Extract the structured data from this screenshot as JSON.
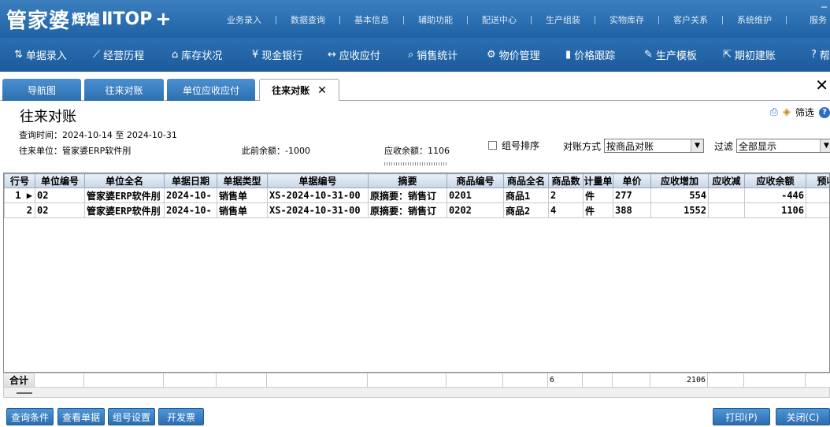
{
  "app": {
    "logo_brand": "管家婆",
    "logo_series": "辉煌",
    "logo_edition": "ⅡTOP",
    "logo_plus": "+"
  },
  "top_menu": [
    "业务录入",
    "数据查询",
    "基本信息",
    "辅助功能",
    "配送中心",
    "生产组装",
    "实物库存",
    "客户关系",
    "系统维护",
    "服务"
  ],
  "toolbar": [
    {
      "label": "单据录入",
      "icon": "document-entry-icon",
      "glyph": "⇅"
    },
    {
      "label": "经营历程",
      "icon": "chart-icon",
      "glyph": "📈"
    },
    {
      "label": "库存状况",
      "icon": "warehouse-icon",
      "glyph": "⌂"
    },
    {
      "label": "现金银行",
      "icon": "yen-icon",
      "glyph": "¥"
    },
    {
      "label": "应收应付",
      "icon": "exchange-icon",
      "glyph": "↔"
    },
    {
      "label": "销售统计",
      "icon": "search-icon",
      "glyph": "⌕"
    },
    {
      "label": "物价管理",
      "icon": "gear-icon",
      "glyph": "⚙"
    },
    {
      "label": "价格跟踪",
      "icon": "bar-chart-icon",
      "glyph": "▮"
    },
    {
      "label": "生产模板",
      "icon": "wrench-icon",
      "glyph": "✎"
    },
    {
      "label": "期初建账",
      "icon": "external-link-icon",
      "glyph": "⇱"
    },
    {
      "label": "帮",
      "icon": "help-icon",
      "glyph": "?"
    }
  ],
  "tabs": [
    {
      "label": "导航图"
    },
    {
      "label": "往来对账"
    },
    {
      "label": "单位应收应付"
    },
    {
      "label": "往来对账",
      "active": true,
      "close": "✕"
    }
  ],
  "close_all": "✕",
  "page": {
    "title": "往来对账",
    "query_time": "查询时间：2024-10-14 至 2024-10-31",
    "unit": "往来单位：管家婆ERP软件刖",
    "prev_balance": "此前余额：-1000",
    "receivable_balance": "应收余额：1106",
    "filter_label": "筛选",
    "group_sort_label": "组号排序",
    "method_label": "对账方式",
    "method_value": "按商品对账",
    "filter_by_label": "过滤",
    "filter_by_value": "全部显示"
  },
  "table": {
    "columns": [
      "行号",
      "单位编号",
      "单位全名",
      "单据日期",
      "单据类型",
      "单据编号",
      "摘要",
      "商品编号",
      "商品全名",
      "商品数",
      "计量单",
      "单价",
      "应收增加",
      "应收减",
      "应收余额",
      "预收"
    ],
    "rows": [
      {
        "no": "1",
        "marker": "▶",
        "unit_code": "02",
        "unit_name": "管家婆ERP软件刖",
        "date": "2024-10-",
        "type": "销售单",
        "doc_no": "XS-2024-10-31-00",
        "summary": "原摘要：销售订",
        "goods_code": "0201",
        "goods_name": "商品1",
        "qty": "2",
        "uom": "件",
        "price": "277",
        "rec_inc": "554",
        "rec_dec": "",
        "rec_bal": "-446",
        "pre": ""
      },
      {
        "no": "2",
        "marker": "",
        "unit_code": "02",
        "unit_name": "管家婆ERP软件刖",
        "date": "2024-10-",
        "type": "销售单",
        "doc_no": "XS-2024-10-31-00",
        "summary": "原摘要：销售订",
        "goods_code": "0202",
        "goods_name": "商品2",
        "qty": "4",
        "uom": "件",
        "price": "388",
        "rec_inc": "1552",
        "rec_dec": "",
        "rec_bal": "1106",
        "pre": ""
      }
    ],
    "totals": {
      "label": "合计",
      "qty": "6",
      "rec_inc": "2106"
    }
  },
  "buttons": {
    "query_conditions": "查询条件",
    "view_doc": "查看单据",
    "group_settings": "组号设置",
    "invoice": "开发票",
    "print": "打印(P)",
    "close": "关闭(C)"
  }
}
